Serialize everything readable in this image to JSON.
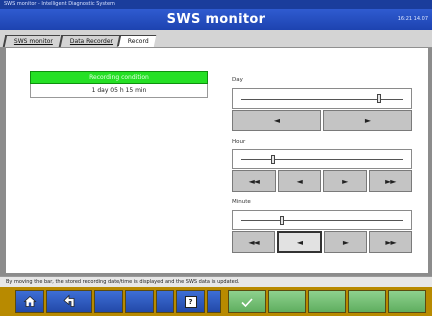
{
  "window": {
    "title": "SWS monitor - Intelligent Diagnostic System"
  },
  "header": {
    "title": "SWS monitor",
    "clock": "16:21 14.07"
  },
  "tabs": [
    {
      "label": "SWS monitor"
    },
    {
      "label": "Data Recorder"
    },
    {
      "label": "Record"
    }
  ],
  "recording": {
    "status_label": "Recording condition",
    "time_label": "1 day 05 h 15 min"
  },
  "sliders": [
    {
      "label": "Day",
      "position": 0.85,
      "buttons": [
        "◄",
        "►"
      ]
    },
    {
      "label": "Hour",
      "position": 0.2,
      "buttons": [
        "◄◄",
        "◄",
        "►",
        "►►"
      ]
    },
    {
      "label": "Minute",
      "position": 0.25,
      "buttons": [
        "◄◄",
        "◄",
        "►",
        "►►"
      ],
      "pressed": 1
    }
  ],
  "message": {
    "text": "By moving the bar, the stored recording date/time is displayed and the SWS data is updated."
  },
  "fkeys": {
    "home": "⌂",
    "back": "⮤",
    "help": "?",
    "ok": "✓"
  },
  "colors": {
    "title_blue": "#1d43b0",
    "status_green": "#25e025",
    "fkey_bar": "#b88a00",
    "fkey_blue": "#2349a8",
    "fkey_green": "#5fae5f"
  }
}
